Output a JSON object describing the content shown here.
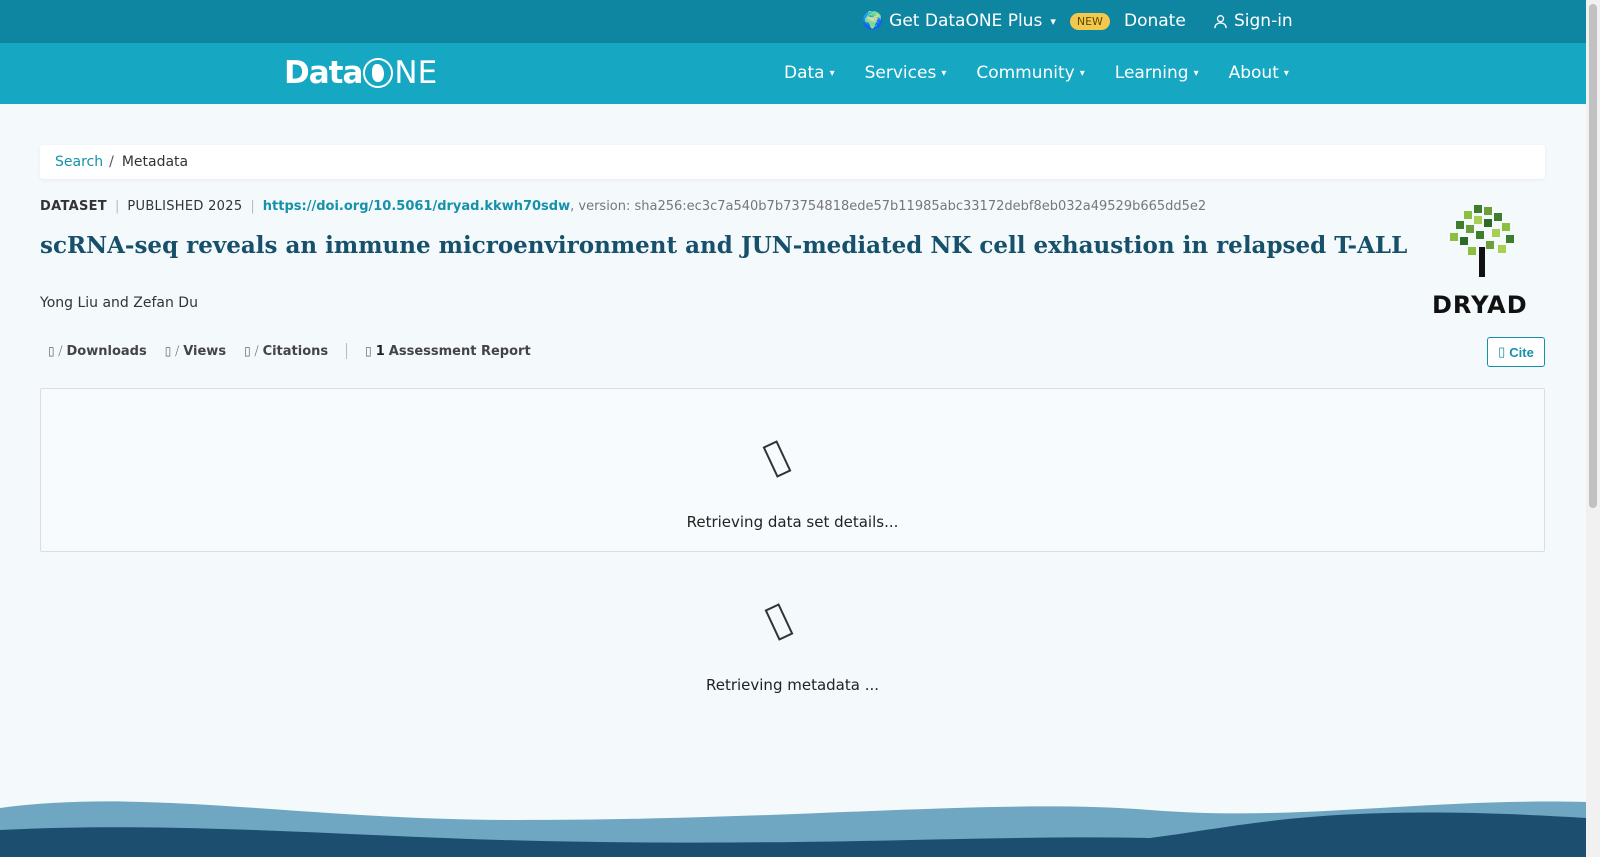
{
  "topbar": {
    "plus_label": "Get DataONE Plus",
    "plus_badge": "NEW",
    "donate_label": "Donate",
    "signin_label": "Sign-in"
  },
  "logo": {
    "part1": "Data",
    "part2": "NE"
  },
  "nav": {
    "items": [
      {
        "label": "Data"
      },
      {
        "label": "Services"
      },
      {
        "label": "Community"
      },
      {
        "label": "Learning"
      },
      {
        "label": "About"
      }
    ]
  },
  "breadcrumb": {
    "search": "Search",
    "separator": "/",
    "current": "Metadata"
  },
  "dataset": {
    "type": "DATASET",
    "published": "PUBLISHED 2025",
    "doi": "https://doi.org/10.5061/dryad.kkwh70sdw",
    "version": ", version: sha256:ec3c7a540b7b73754818ede57b11985abc33172debf8eb032a49529b665dd5e2",
    "title": "scRNA-seq reveals an immune microenvironment and JUN-mediated NK cell exhaustion in relapsed T-ALL",
    "authors": "Yong Liu and Zefan Du"
  },
  "repository": {
    "name": "DRYAD"
  },
  "metrics": {
    "downloads": "Downloads",
    "views": "Views",
    "citations": "Citations",
    "assessment_count": "1",
    "assessment_label": "Assessment Report"
  },
  "cite_label": "Cite",
  "loading": {
    "details": "Retrieving data set details...",
    "metadata": "Retrieving metadata ..."
  },
  "colors": {
    "topbar": "#0e86a1",
    "nav": "#16a7c3",
    "accent": "#1591aa",
    "title": "#17506a"
  }
}
